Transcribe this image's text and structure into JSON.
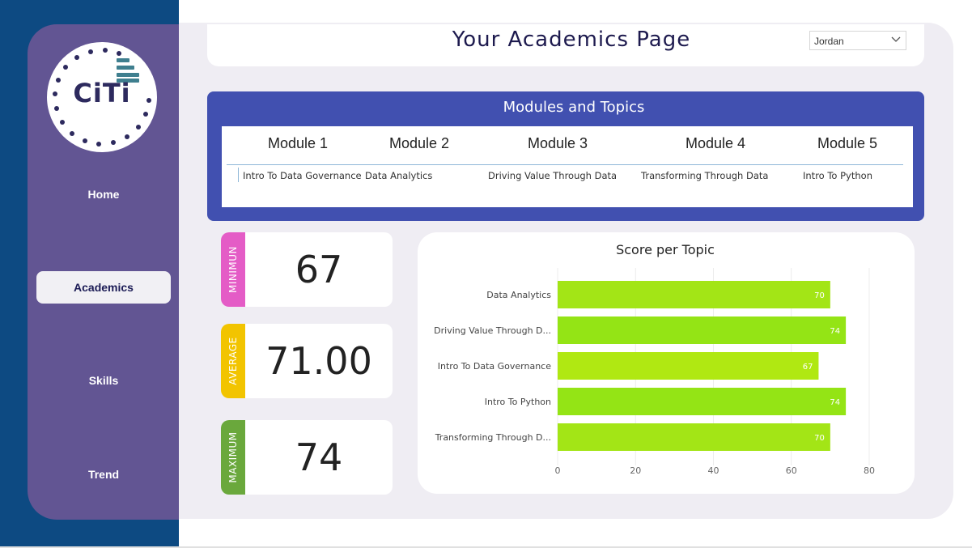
{
  "logo": {
    "text": "CiTi"
  },
  "sidebar": {
    "items": [
      {
        "label": "Home"
      },
      {
        "label": "Academics"
      },
      {
        "label": "Skills"
      },
      {
        "label": "Trend"
      }
    ]
  },
  "header": {
    "title": "Your Academics Page",
    "user_select": {
      "value": "Jordan"
    }
  },
  "modules": {
    "title": "Modules and Topics",
    "columns": [
      {
        "header": "Module 1",
        "topic": "Intro To Data Governance"
      },
      {
        "header": "Module 2",
        "topic": "Data Analytics"
      },
      {
        "header": "Module 3",
        "topic": "Driving Value Through Data"
      },
      {
        "header": "Module 4",
        "topic": "Transforming Through Data"
      },
      {
        "header": "Module 5",
        "topic": "Intro To Python"
      }
    ]
  },
  "kpis": {
    "minimum": {
      "label": "MINIMUN",
      "value": "67",
      "color": "#e45cc6"
    },
    "average": {
      "label": "AVERAGE",
      "value": "71.00",
      "color": "#f2c400"
    },
    "maximum": {
      "label": "MAXIMUM",
      "value": "74",
      "color": "#6aa83c"
    }
  },
  "chart_data": {
    "type": "bar",
    "orientation": "horizontal",
    "title": "Score per Topic",
    "categories": [
      "Data Analytics",
      "Driving Value Through D...",
      "Intro To Data Governance",
      "Intro To Python",
      "Transforming Through D..."
    ],
    "values": [
      70,
      74,
      67,
      74,
      70
    ],
    "data_labels": [
      "70",
      "74",
      "67",
      "74",
      "70"
    ],
    "xlim": [
      0,
      80
    ],
    "x_ticks": [
      "0",
      "20",
      "40",
      "60",
      "80"
    ],
    "bar_colors": [
      "#a3e516",
      "#94e415",
      "#b0e812",
      "#94e415",
      "#a3e516"
    ],
    "grid": true
  }
}
